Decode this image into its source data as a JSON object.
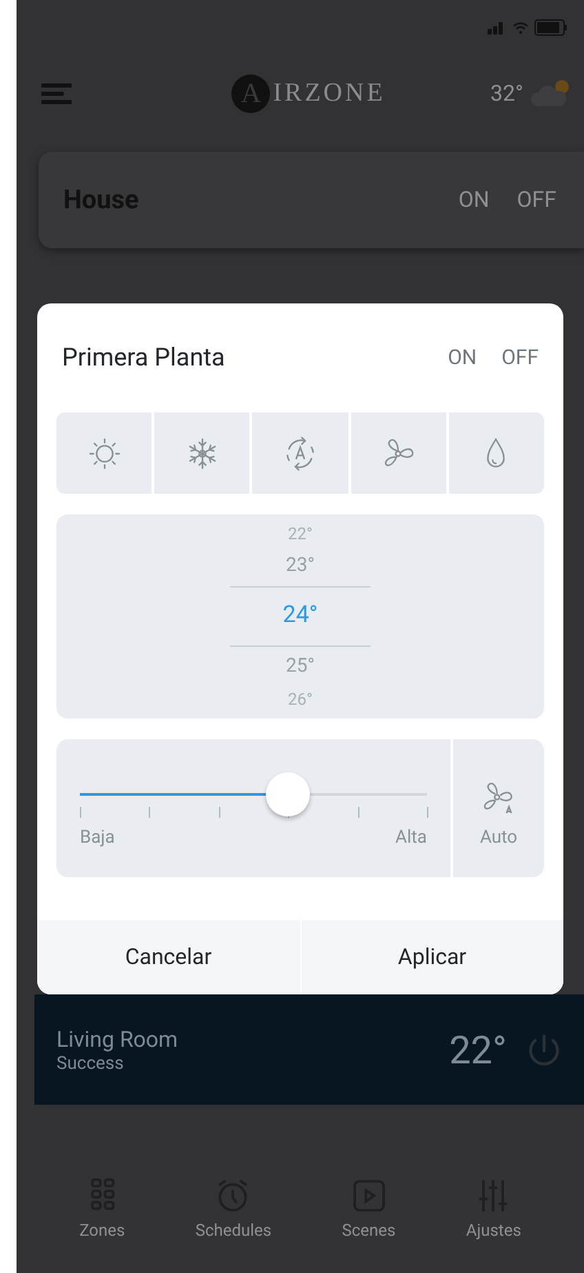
{
  "header": {
    "logo_letter": "A",
    "logo_text": "IRZONE",
    "weather_temp": "32°"
  },
  "house": {
    "title": "House",
    "on_label": "ON",
    "off_label": "OFF"
  },
  "dialog": {
    "title": "Primera Planta",
    "on_label": "ON",
    "off_label": "OFF",
    "modes": [
      {
        "kind": "heat",
        "selected": false
      },
      {
        "kind": "cool",
        "selected": false
      },
      {
        "kind": "auto",
        "selected": false
      },
      {
        "kind": "fan",
        "selected": false
      },
      {
        "kind": "dry",
        "selected": false
      }
    ],
    "temperatures": [
      {
        "label": "22°",
        "selected": false
      },
      {
        "label": "23°",
        "selected": false
      },
      {
        "label": "24°",
        "selected": true
      },
      {
        "label": "25°",
        "selected": false
      },
      {
        "label": "26°",
        "selected": false
      }
    ],
    "fan_speed": {
      "level": 0.6,
      "min_label": "Baja",
      "max_label": "Alta",
      "auto_label": "Auto"
    },
    "buttons": [
      "Cancelar",
      "Aplicar"
    ]
  },
  "zone": {
    "name": "Living Room",
    "status": "Success",
    "temperature": "22°"
  },
  "nav": [
    {
      "kind": "zones",
      "label": "Zones"
    },
    {
      "kind": "schedules",
      "label": "Schedules"
    },
    {
      "kind": "scenes",
      "label": "Scenes"
    },
    {
      "kind": "settings",
      "label": "Ajustes"
    }
  ]
}
